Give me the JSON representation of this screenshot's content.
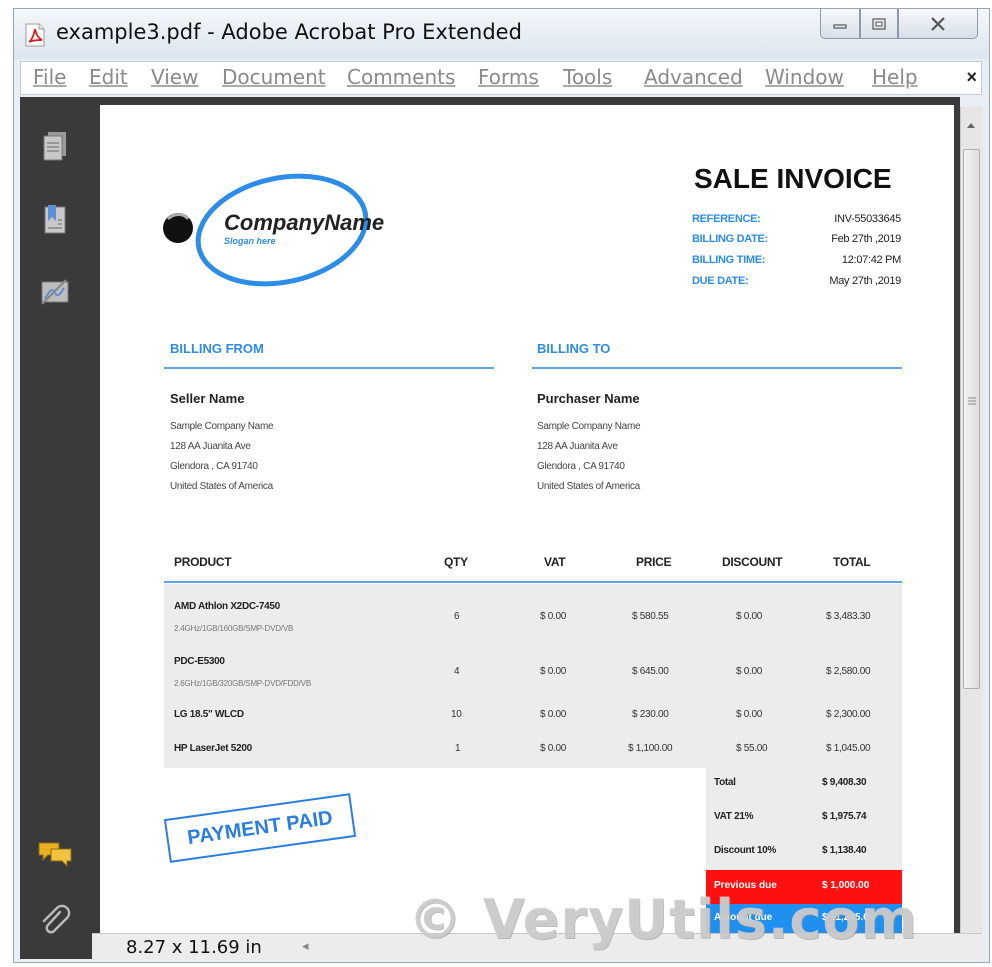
{
  "window": {
    "title": "example3.pdf - Adobe Acrobat Pro Extended"
  },
  "menu": {
    "items": [
      "File",
      "Edit",
      "View",
      "Document",
      "Comments",
      "Forms",
      "Tools",
      "Advanced",
      "Window",
      "Help"
    ],
    "close": "×"
  },
  "status": {
    "page_size": "8.27 x 11.69 in",
    "scroll_left": "◂"
  },
  "invoice": {
    "logo": {
      "company": "CompanyName",
      "slogan": "Slogan here"
    },
    "heading": "SALE INVOICE",
    "meta": [
      {
        "label": "REFERENCE:",
        "value": "INV-55033645"
      },
      {
        "label": "BILLING DATE:",
        "value": "Feb 27th ,2019"
      },
      {
        "label": "BILLING TIME:",
        "value": "12:07:42 PM"
      },
      {
        "label": "DUE DATE:",
        "value": "May 27th ,2019"
      }
    ],
    "billing_from": {
      "heading": "BILLING FROM",
      "name": "Seller Name",
      "lines": [
        "Sample Company Name",
        "128 AA Juanita Ave",
        "Glendora , CA 91740",
        "United States of America"
      ]
    },
    "billing_to": {
      "heading": "BILLING TO",
      "name": "Purchaser Name",
      "lines": [
        "Sample Company Name",
        "128 AA Juanita Ave",
        "Glendora , CA 91740",
        "United States of America"
      ]
    },
    "columns": [
      "PRODUCT",
      "QTY",
      "VAT",
      "PRICE",
      "DISCOUNT",
      "TOTAL"
    ],
    "rows": [
      {
        "name": "AMD Athlon X2DC-7450",
        "spec": "2.4GHz/1GB/160GB/SMP-DVD/VB",
        "qty": "6",
        "vat": "$ 0.00",
        "price": "$ 580.55",
        "discount": "$ 0.00",
        "total": "$ 3,483.30"
      },
      {
        "name": "PDC-E5300",
        "spec": "2.6GHz/1GB/320GB/SMP-DVD/FDD/VB",
        "qty": "4",
        "vat": "$ 0.00",
        "price": "$ 645.00",
        "discount": "$ 0.00",
        "total": "$ 2,580.00"
      },
      {
        "name": "LG 18.5\" WLCD",
        "spec": "",
        "qty": "10",
        "vat": "$ 0.00",
        "price": "$ 230.00",
        "discount": "$ 0.00",
        "total": "$ 2,300.00"
      },
      {
        "name": "HP LaserJet 5200",
        "spec": "",
        "qty": "1",
        "vat": "$ 0.00",
        "price": "$ 1,100.00",
        "discount": "$ 55.00",
        "total": "$ 1,045.00"
      }
    ],
    "summary": [
      {
        "label": "Total",
        "value": "$ 9,408.30"
      },
      {
        "label": "VAT 21%",
        "value": "$ 1,975.74"
      },
      {
        "label": "Discount 10%",
        "value": "$ 1,138.40"
      }
    ],
    "previous_due": {
      "label": "Previous due",
      "value": "$ 1,000.00"
    },
    "amount_due": {
      "label": "Amount due",
      "value": "$ 11,245.64"
    },
    "stamp": "PAYMENT PAID"
  },
  "watermark": "© VeryUtils.com",
  "colors": {
    "accent_blue": "#2d8ce8",
    "previous_due_red": "#ff1010",
    "amount_due_blue": "#1f8ff0",
    "sidebar_dark": "#3a3a3a"
  },
  "icons": [
    "acrobat-pdf-icon",
    "minimize-icon",
    "maximize-icon",
    "close-icon",
    "pages-icon",
    "bookmarks-icon",
    "signatures-icon",
    "comments-icon",
    "attachments-icon"
  ]
}
